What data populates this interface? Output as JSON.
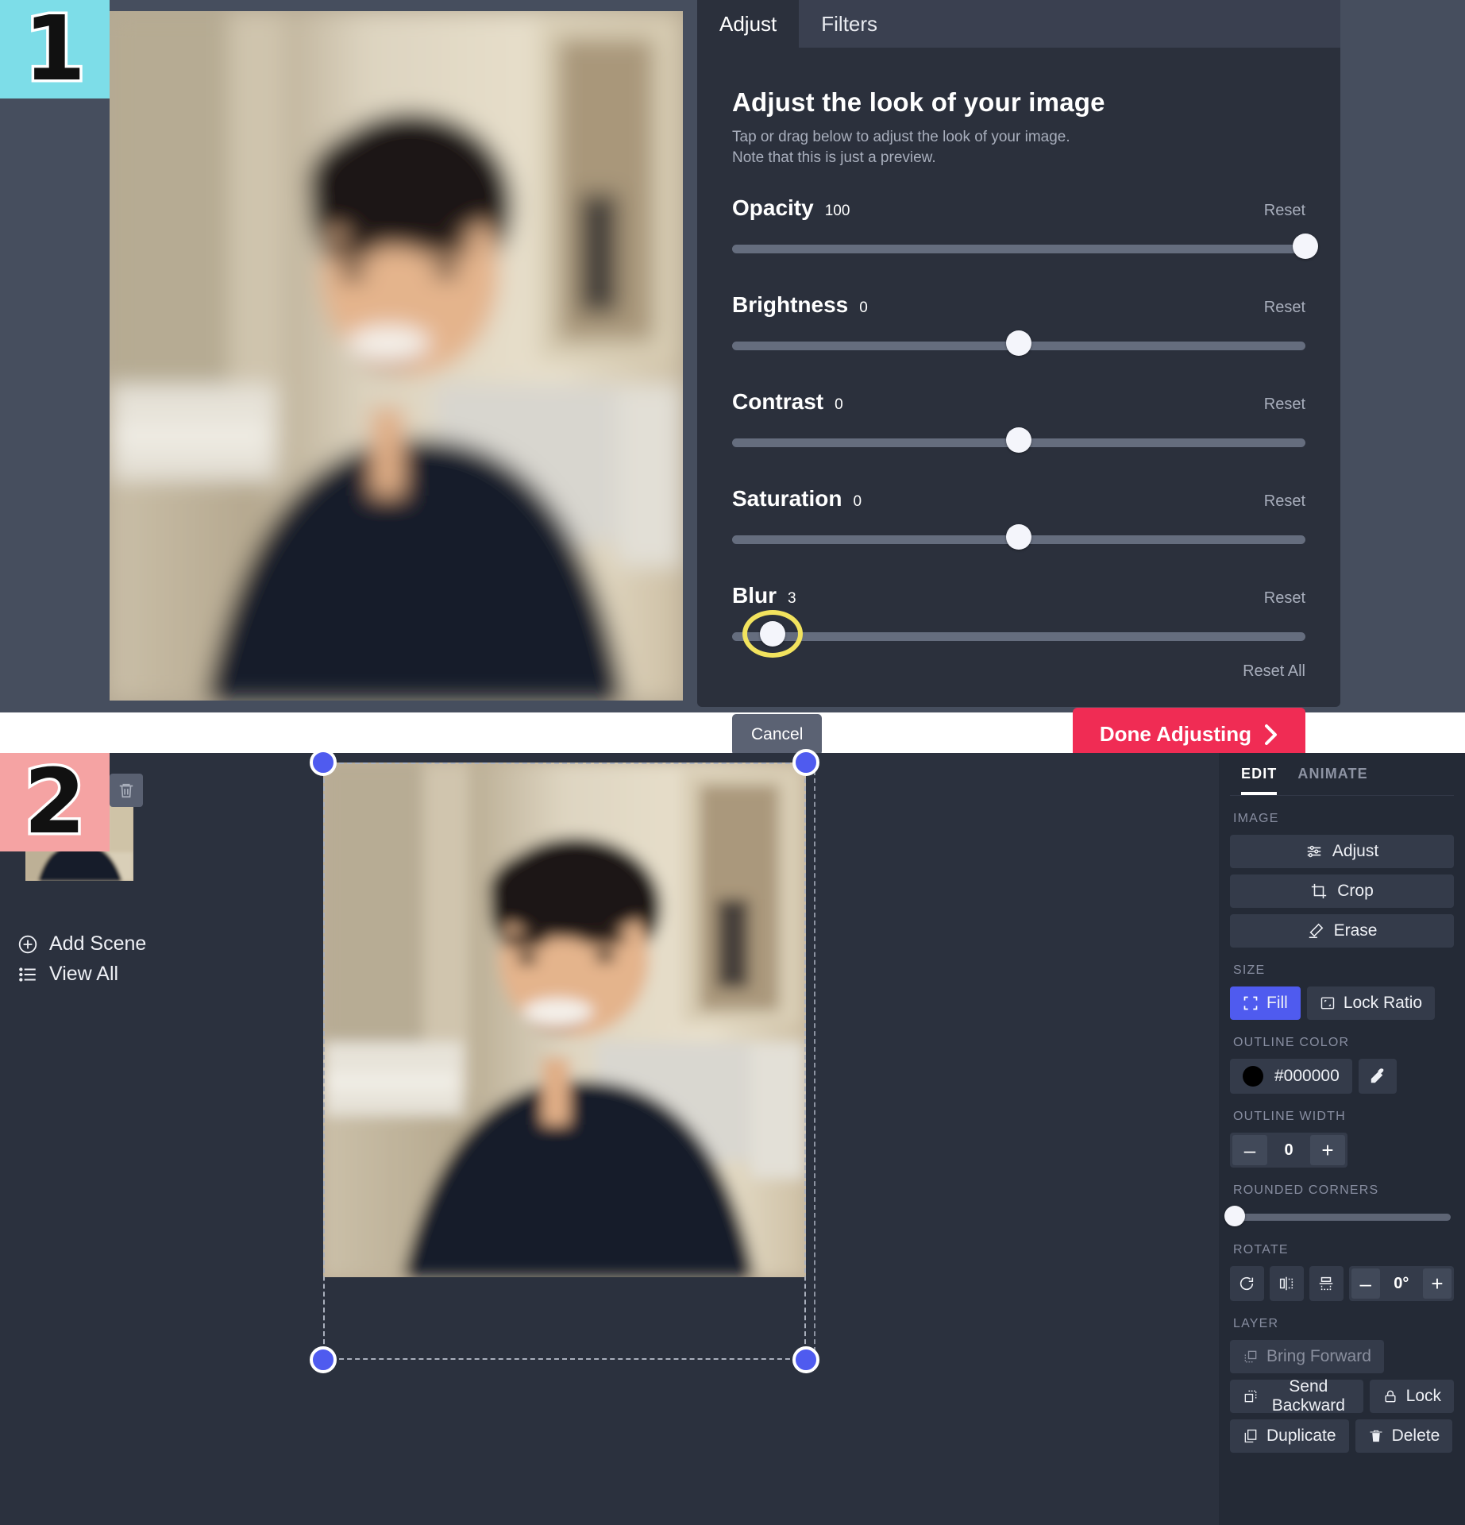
{
  "steps": {
    "one": "1",
    "two": "2",
    "color_one": "#7ddde8",
    "color_two": "#f5a3a3"
  },
  "panel1": {
    "tabs": [
      {
        "label": "Adjust",
        "active": true
      },
      {
        "label": "Filters",
        "active": false
      }
    ],
    "title": "Adjust the look of your image",
    "subtitle_line1": "Tap or drag below to adjust the look of your image.",
    "subtitle_line2": "Note that this is just a preview.",
    "reset_label": "Reset",
    "reset_all_label": "Reset All",
    "sliders": [
      {
        "name": "Opacity",
        "value": "100",
        "percent": 100,
        "highlighted": false
      },
      {
        "name": "Brightness",
        "value": "0",
        "percent": 50,
        "highlighted": false
      },
      {
        "name": "Contrast",
        "value": "0",
        "percent": 50,
        "highlighted": false
      },
      {
        "name": "Saturation",
        "value": "0",
        "percent": 50,
        "highlighted": false
      },
      {
        "name": "Blur",
        "value": "3",
        "percent": 7,
        "highlighted": true
      }
    ],
    "cancel_label": "Cancel",
    "done_label": "Done Adjusting",
    "done_color": "#f02c54"
  },
  "panel2": {
    "rail": {
      "delete_icon": "trash-icon",
      "add_scene_label": "Add Scene",
      "view_all_label": "View All"
    },
    "sidebar": {
      "tabs": [
        {
          "label": "EDIT",
          "active": true
        },
        {
          "label": "ANIMATE",
          "active": false
        }
      ],
      "sections": {
        "image": {
          "heading": "IMAGE",
          "buttons": [
            {
              "label": "Adjust",
              "icon": "sliders-icon"
            },
            {
              "label": "Crop",
              "icon": "crop-icon"
            },
            {
              "label": "Erase",
              "icon": "eraser-icon"
            }
          ]
        },
        "size": {
          "heading": "SIZE",
          "fill_label": "Fill",
          "fill_active": true,
          "fill_color": "#4f5bef",
          "lock_ratio_label": "Lock Ratio"
        },
        "outline_color": {
          "heading": "OUTLINE COLOR",
          "value": "#000000",
          "eyedropper_icon": "eyedropper-icon"
        },
        "outline_width": {
          "heading": "OUTLINE WIDTH",
          "value": "0",
          "minus_label": "–",
          "plus_label": "+"
        },
        "rounded_corners": {
          "heading": "ROUNDED CORNERS",
          "percent": 1
        },
        "rotate": {
          "heading": "ROTATE",
          "value": "0°",
          "minus_label": "–",
          "plus_label": "+",
          "icons": [
            "rotate-icon",
            "flip-horizontal-icon",
            "flip-vertical-icon"
          ]
        },
        "layer": {
          "heading": "LAYER",
          "buttons": [
            {
              "label": "Bring Forward",
              "icon": "bring-forward-icon",
              "disabled": true
            },
            {
              "label": "Send Backward",
              "icon": "send-backward-icon",
              "disabled": false
            },
            {
              "label": "Lock",
              "icon": "lock-icon",
              "disabled": false
            },
            {
              "label": "Duplicate",
              "icon": "duplicate-icon",
              "disabled": false
            },
            {
              "label": "Delete",
              "icon": "trash-icon",
              "disabled": false
            }
          ]
        }
      }
    }
  }
}
